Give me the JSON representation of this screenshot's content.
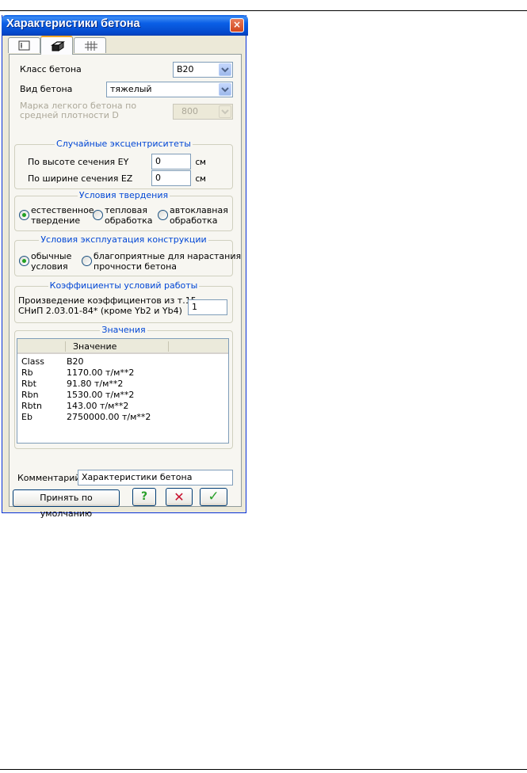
{
  "window": {
    "title": "Характеристики бетона",
    "close_glyph": "×"
  },
  "tabs": [
    {
      "icon": "list-icon",
      "active": false
    },
    {
      "icon": "cube-icon",
      "active": true
    },
    {
      "icon": "rebar-grid-icon",
      "active": false
    }
  ],
  "concrete": {
    "class_label": "Класс бетона",
    "class_value": "B20",
    "type_label": "Вид бетона",
    "type_value": "тяжелый",
    "grade_label_line1": "Марка легкого бетона по",
    "grade_label_line2": "средней плотности D",
    "grade_value": "800"
  },
  "eccentricities": {
    "title": "Случайные эксцентриситеты",
    "height_label": "По высоте сечения   EY",
    "height_value": "0",
    "width_label": "По ширине сечения   EZ",
    "width_value": "0",
    "unit": "см"
  },
  "hardening": {
    "title": "Условия твердения",
    "options": [
      {
        "line1": "естественное",
        "line2": "твердение",
        "selected": true
      },
      {
        "line1": "тепловая",
        "line2": "обработка",
        "selected": false
      },
      {
        "line1": "автоклавная",
        "line2": "обработка",
        "selected": false
      }
    ]
  },
  "operation": {
    "title": "Условия эксплуатация конструкции",
    "options": [
      {
        "line1": "обычные",
        "line2": "условия",
        "selected": true
      },
      {
        "line1": "благоприятные для нарастания",
        "line2": "прочности бетона",
        "selected": false
      }
    ]
  },
  "coefficients": {
    "title": "Коэффициенты условий работы",
    "label_line1": "Произведение коэффициентов из т.15",
    "label_line2": "СНиП 2.03.01-84* (кроме Yb2 и Yb4)",
    "value": "1"
  },
  "values": {
    "title": "Значения",
    "column_header": "Значение",
    "rows": [
      {
        "name": "Class",
        "value": "B20"
      },
      {
        "name": "Rb",
        "value": "1170.00 т/м**2"
      },
      {
        "name": "Rbt",
        "value": "91.80 т/м**2"
      },
      {
        "name": "Rbn",
        "value": "1530.00 т/м**2"
      },
      {
        "name": "Rbtn",
        "value": "143.00 т/м**2"
      },
      {
        "name": "Eb",
        "value": "2750000.00 т/м**2"
      }
    ]
  },
  "comment": {
    "label": "Комментарий",
    "value": "Характеристики бетона"
  },
  "buttons": {
    "default_label": "Принять по умолчанию",
    "help_glyph": "?",
    "cancel_glyph": "✕",
    "ok_glyph": "✓"
  },
  "colors": {
    "titlebar": "#0a5fe6",
    "group_title": "#0046d5",
    "help_green": "#2aa02a",
    "cancel_red": "#c8102e",
    "ok_green": "#2aa02a"
  }
}
